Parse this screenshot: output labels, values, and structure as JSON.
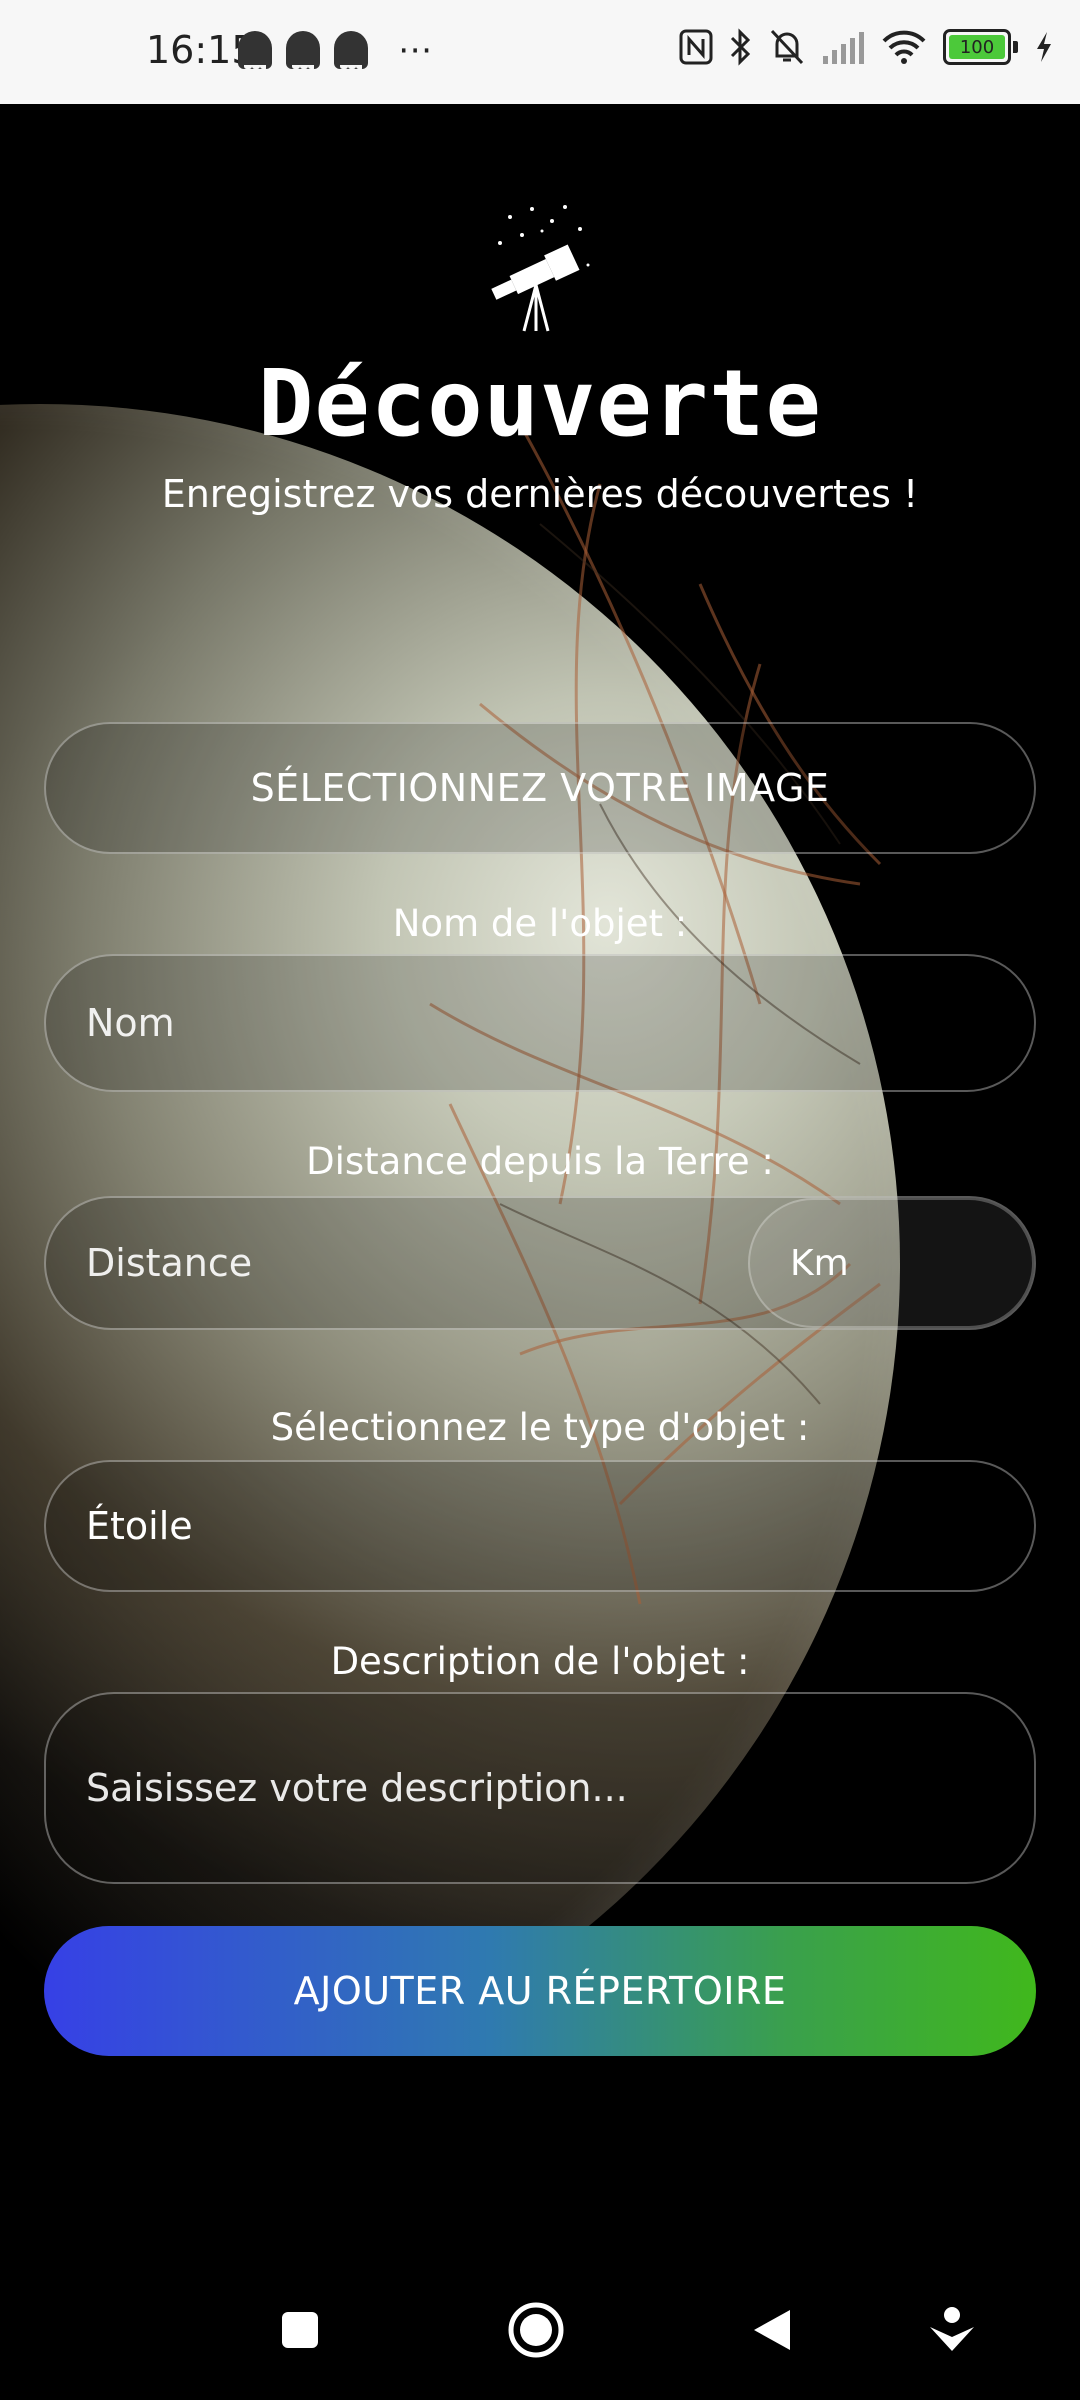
{
  "status_bar": {
    "time": "16:15",
    "battery_level": "100",
    "overflow_glyph": "⋯",
    "icons": [
      "snapchat-icon",
      "snapchat-icon",
      "snapchat-icon",
      "more-icon",
      "nfc-icon",
      "bluetooth-icon",
      "mute-icon",
      "signal-icon",
      "wifi-icon",
      "battery-icon",
      "charging-icon"
    ]
  },
  "header": {
    "title": "Découverte",
    "subtitle": "Enregistrez vos dernières découvertes !",
    "logo_icon": "telescope-icon"
  },
  "form": {
    "select_image_button": "SÉLECTIONNEZ VOTRE IMAGE",
    "name_label": "Nom de l'objet :",
    "name_placeholder": "Nom",
    "distance_label": "Distance depuis la Terre :",
    "distance_placeholder": "Distance",
    "distance_unit": "Km",
    "type_label": "Sélectionnez le type d'objet :",
    "type_value": "Étoile",
    "description_label": "Description de l'objet :",
    "description_placeholder": "Saisissez votre description...",
    "submit_button": "AJOUTER AU RÉPERTOIRE"
  },
  "nav_bar": {
    "icons": [
      "recents-icon",
      "home-icon",
      "back-icon",
      "assistant-icon"
    ]
  },
  "colors": {
    "background": "#000000",
    "button_gradient_start": "#3640e6",
    "button_gradient_end": "#40b81c",
    "battery_green": "#4cc93a"
  }
}
